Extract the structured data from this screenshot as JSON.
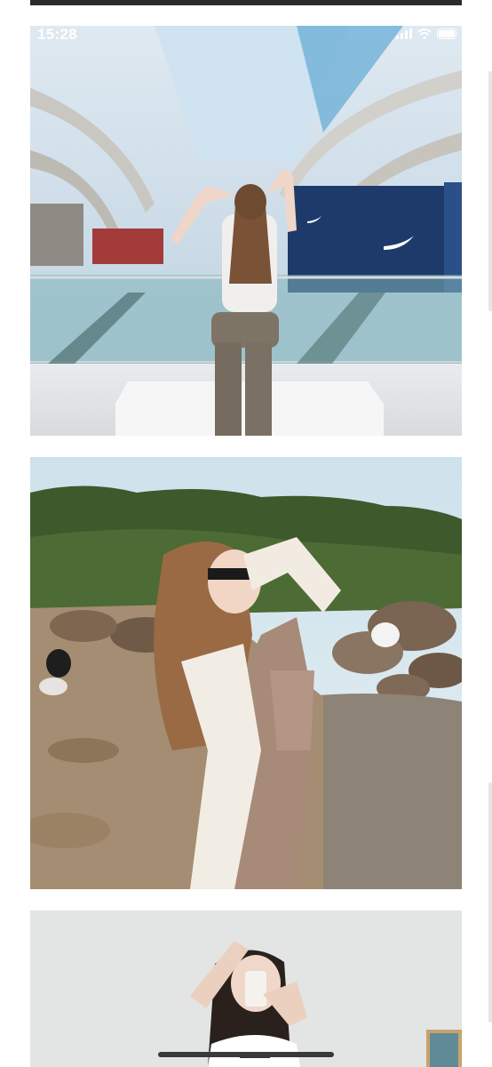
{
  "status_bar": {
    "time": "15:28"
  },
  "feed": {
    "photos": [
      {
        "subject": "mall-photo"
      },
      {
        "subject": "beach-photo"
      },
      {
        "subject": "mirror-selfie-photo"
      }
    ]
  },
  "colors": {
    "background": "#ffffff",
    "home_indicator": "#3a3a3a"
  }
}
